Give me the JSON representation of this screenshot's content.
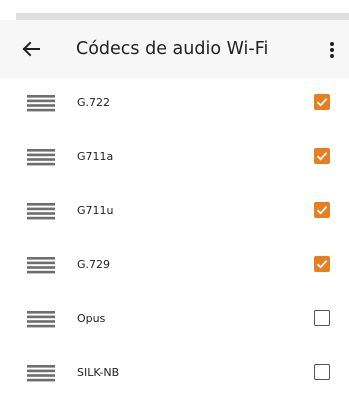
{
  "app_bar": {
    "title": "Códecs de audio Wi-Fi",
    "back_icon": "arrow-left-icon",
    "menu_icon": "more-vert-icon"
  },
  "accent_color": "#e67e22",
  "codecs": [
    {
      "label": "G.722",
      "checked": true
    },
    {
      "label": "G711a",
      "checked": true
    },
    {
      "label": "G711u",
      "checked": true
    },
    {
      "label": "G.729",
      "checked": true
    },
    {
      "label": "Opus",
      "checked": false
    },
    {
      "label": "SILK-NB",
      "checked": false
    }
  ]
}
